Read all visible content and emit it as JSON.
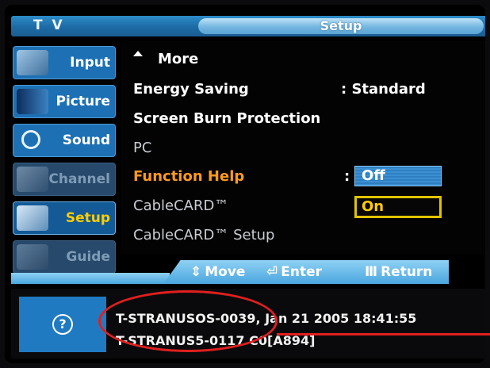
{
  "header": {
    "tv_title": "T V",
    "menu_title": "Setup"
  },
  "sidebar": {
    "items": [
      {
        "label": "Input",
        "icon": "input-icon",
        "state": "normal"
      },
      {
        "label": "Picture",
        "icon": "picture-icon",
        "state": "normal"
      },
      {
        "label": "Sound",
        "icon": "sound-icon",
        "state": "normal"
      },
      {
        "label": "Channel",
        "icon": "channel-icon",
        "state": "disabled"
      },
      {
        "label": "Setup",
        "icon": "setup-icon",
        "state": "active"
      },
      {
        "label": "Guide",
        "icon": "guide-icon",
        "state": "disabled"
      }
    ]
  },
  "menu": {
    "more": "More",
    "energy_saving": {
      "label": "Energy Saving",
      "value": ": Standard"
    },
    "screen_burn": "Screen Burn Protection",
    "pc": "PC",
    "function_help": {
      "label": "Function Help",
      "colon": ":"
    },
    "cablecard": "CableCARD™",
    "cablecard_setup": "CableCARD™ Setup",
    "options": {
      "off": "Off",
      "on": "On"
    }
  },
  "navbar": {
    "move": "Move",
    "enter": "Enter",
    "return": "Return"
  },
  "help": {
    "icon": "?",
    "line1": "T-STRANUSOS-0039, Jan 21 2005 18:41:55",
    "line2": "T-STRANUS5-0117 C0[A894]"
  },
  "colors": {
    "accent_blue": "#1d70b4",
    "highlight_orange": "#ff9a1f",
    "selected_yellow": "#ffcc00",
    "annotation_red": "#e01f1f"
  }
}
